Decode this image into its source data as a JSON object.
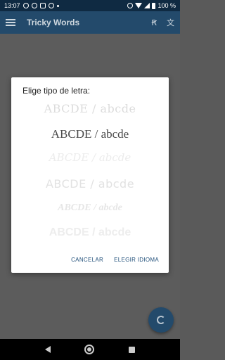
{
  "status_bar": {
    "time": "13:07",
    "battery": "100 %"
  },
  "app_bar": {
    "title": "Tricky Words",
    "icons": [
      "menu-icon",
      "text-format-icon",
      "translate-icon"
    ]
  },
  "dialog": {
    "title": "Elige tipo de letra:",
    "font_options": [
      "ABCDE / abcde",
      "ABCDE / abcde",
      "ABCDE / abcde",
      "ABCDE / abcde",
      "ABCDE / abcde",
      "ABCDE / abcde"
    ],
    "cancel_label": "CANCELAR",
    "confirm_label": "ELEGIR IDIOMA"
  },
  "fab": {
    "icon": "refresh-icon"
  },
  "colors": {
    "primary": "#234a6b",
    "status_bar": "#0f2a42",
    "accent_text": "#1f4e79"
  }
}
